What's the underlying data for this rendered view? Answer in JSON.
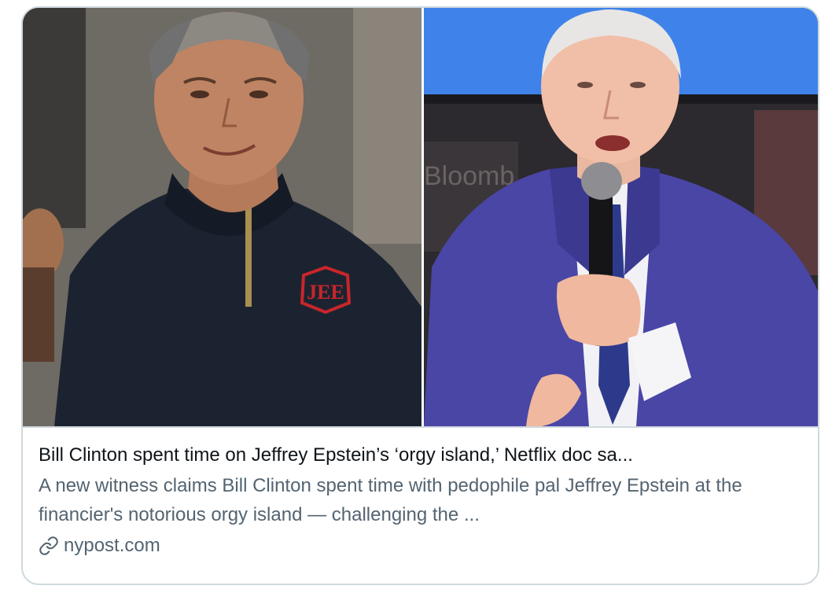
{
  "card": {
    "title": "Bill Clinton spent time on Jeffrey Epstein’s ‘orgy island,’ Netflix doc sa...",
    "description": "A new witness claims Bill Clinton spent time with pedophile pal Jeffrey Epstein at the financier's notorious orgy island — challenging the ...",
    "domain": "nypost.com",
    "link_icon": "link-icon"
  },
  "media": {
    "left_image": "photo-man-dark-sweater-monogram",
    "right_image": "photo-man-blue-suit-microphone",
    "monogram_text": "JEE",
    "background_text": "Bloomb"
  },
  "colors": {
    "title": "#0f1419",
    "secondary": "#536471",
    "border": "#cfd9de"
  }
}
